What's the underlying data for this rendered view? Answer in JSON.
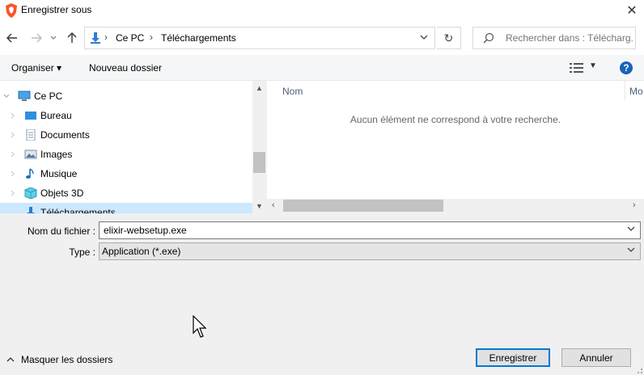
{
  "window": {
    "title": "Enregistrer sous",
    "close_glyph": "✕"
  },
  "address_bar": {
    "breadcrumbs": [
      "Ce PC",
      "Téléchargements"
    ],
    "separator": "›"
  },
  "search": {
    "placeholder": "Rechercher dans : Télécharg..."
  },
  "toolbar": {
    "organize_label": "Organiser ▾",
    "new_folder_label": "Nouveau dossier",
    "help_label": "?"
  },
  "nav_tree": {
    "items": [
      {
        "label": "Ce PC",
        "icon": "computer-icon"
      },
      {
        "label": "Bureau",
        "icon": "desktop-folder-icon"
      },
      {
        "label": "Documents",
        "icon": "documents-folder-icon"
      },
      {
        "label": "Images",
        "icon": "pictures-folder-icon"
      },
      {
        "label": "Musique",
        "icon": "music-folder-icon"
      },
      {
        "label": "Objets 3D",
        "icon": "3d-objects-folder-icon"
      },
      {
        "label": "Téléchargements",
        "icon": "downloads-folder-icon"
      }
    ]
  },
  "file_list": {
    "columns": [
      "Nom",
      "Mo"
    ],
    "empty_message": "Aucun élément ne correspond à votre recherche."
  },
  "form": {
    "filename_label": "Nom du fichier :",
    "filename_value": "elixir-websetup.exe",
    "type_label": "Type :",
    "type_value": "Application (*.exe)"
  },
  "footer": {
    "hide_folders_label": "Masquer les dossiers",
    "save_label": "Enregistrer",
    "cancel_label": "Annuler"
  },
  "colors": {
    "accent": "#0078d7",
    "selection": "#cce8ff"
  }
}
